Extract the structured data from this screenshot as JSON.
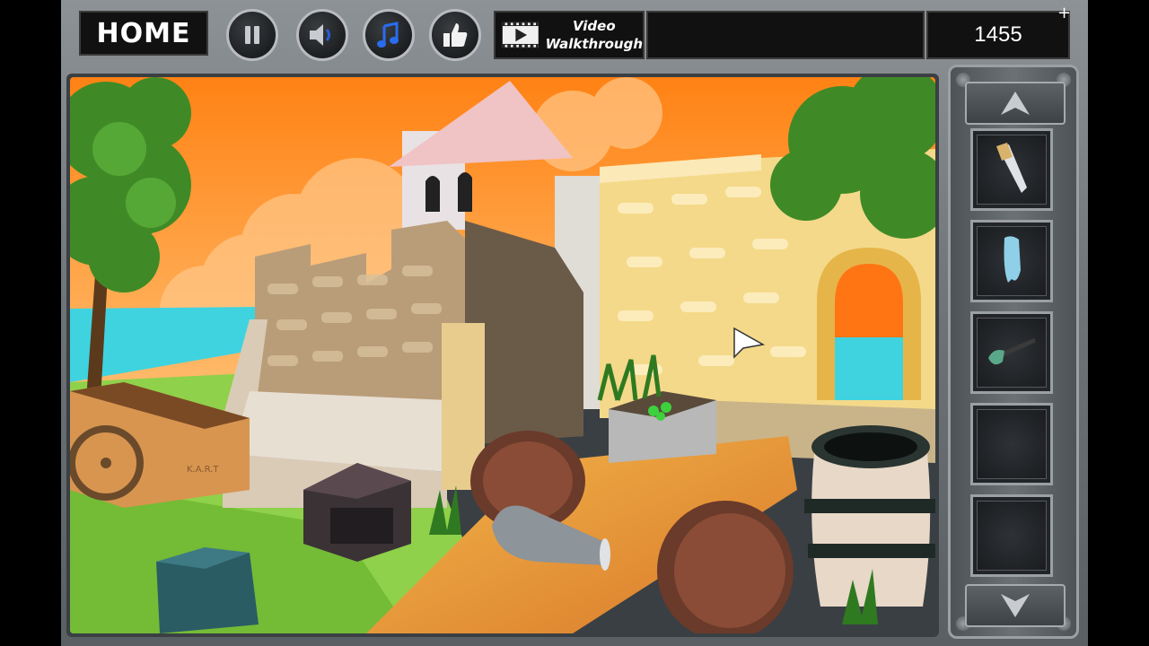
{
  "toolbar": {
    "home_label": "HOME",
    "video_label_line1": "Video",
    "video_label_line2": "Walkthrough",
    "score": "1455",
    "plus": "+",
    "buttons": [
      "pause-icon",
      "speaker-icon",
      "music-note-icon",
      "thumbs-up-icon"
    ]
  },
  "scene": {
    "cart_label": "K.A.R.T"
  },
  "inventory": {
    "items": [
      "saw-icon",
      "cloth-icon",
      "shovel-icon",
      "",
      ""
    ]
  },
  "colors": {
    "sky_top": "#ff8a1f",
    "sky_bottom": "#ffb566",
    "sea": "#3fd3e0",
    "grass": "#8fd14a",
    "wall": "#f4d98a",
    "stone": "#bfa583",
    "score_text": "#ffffff"
  }
}
